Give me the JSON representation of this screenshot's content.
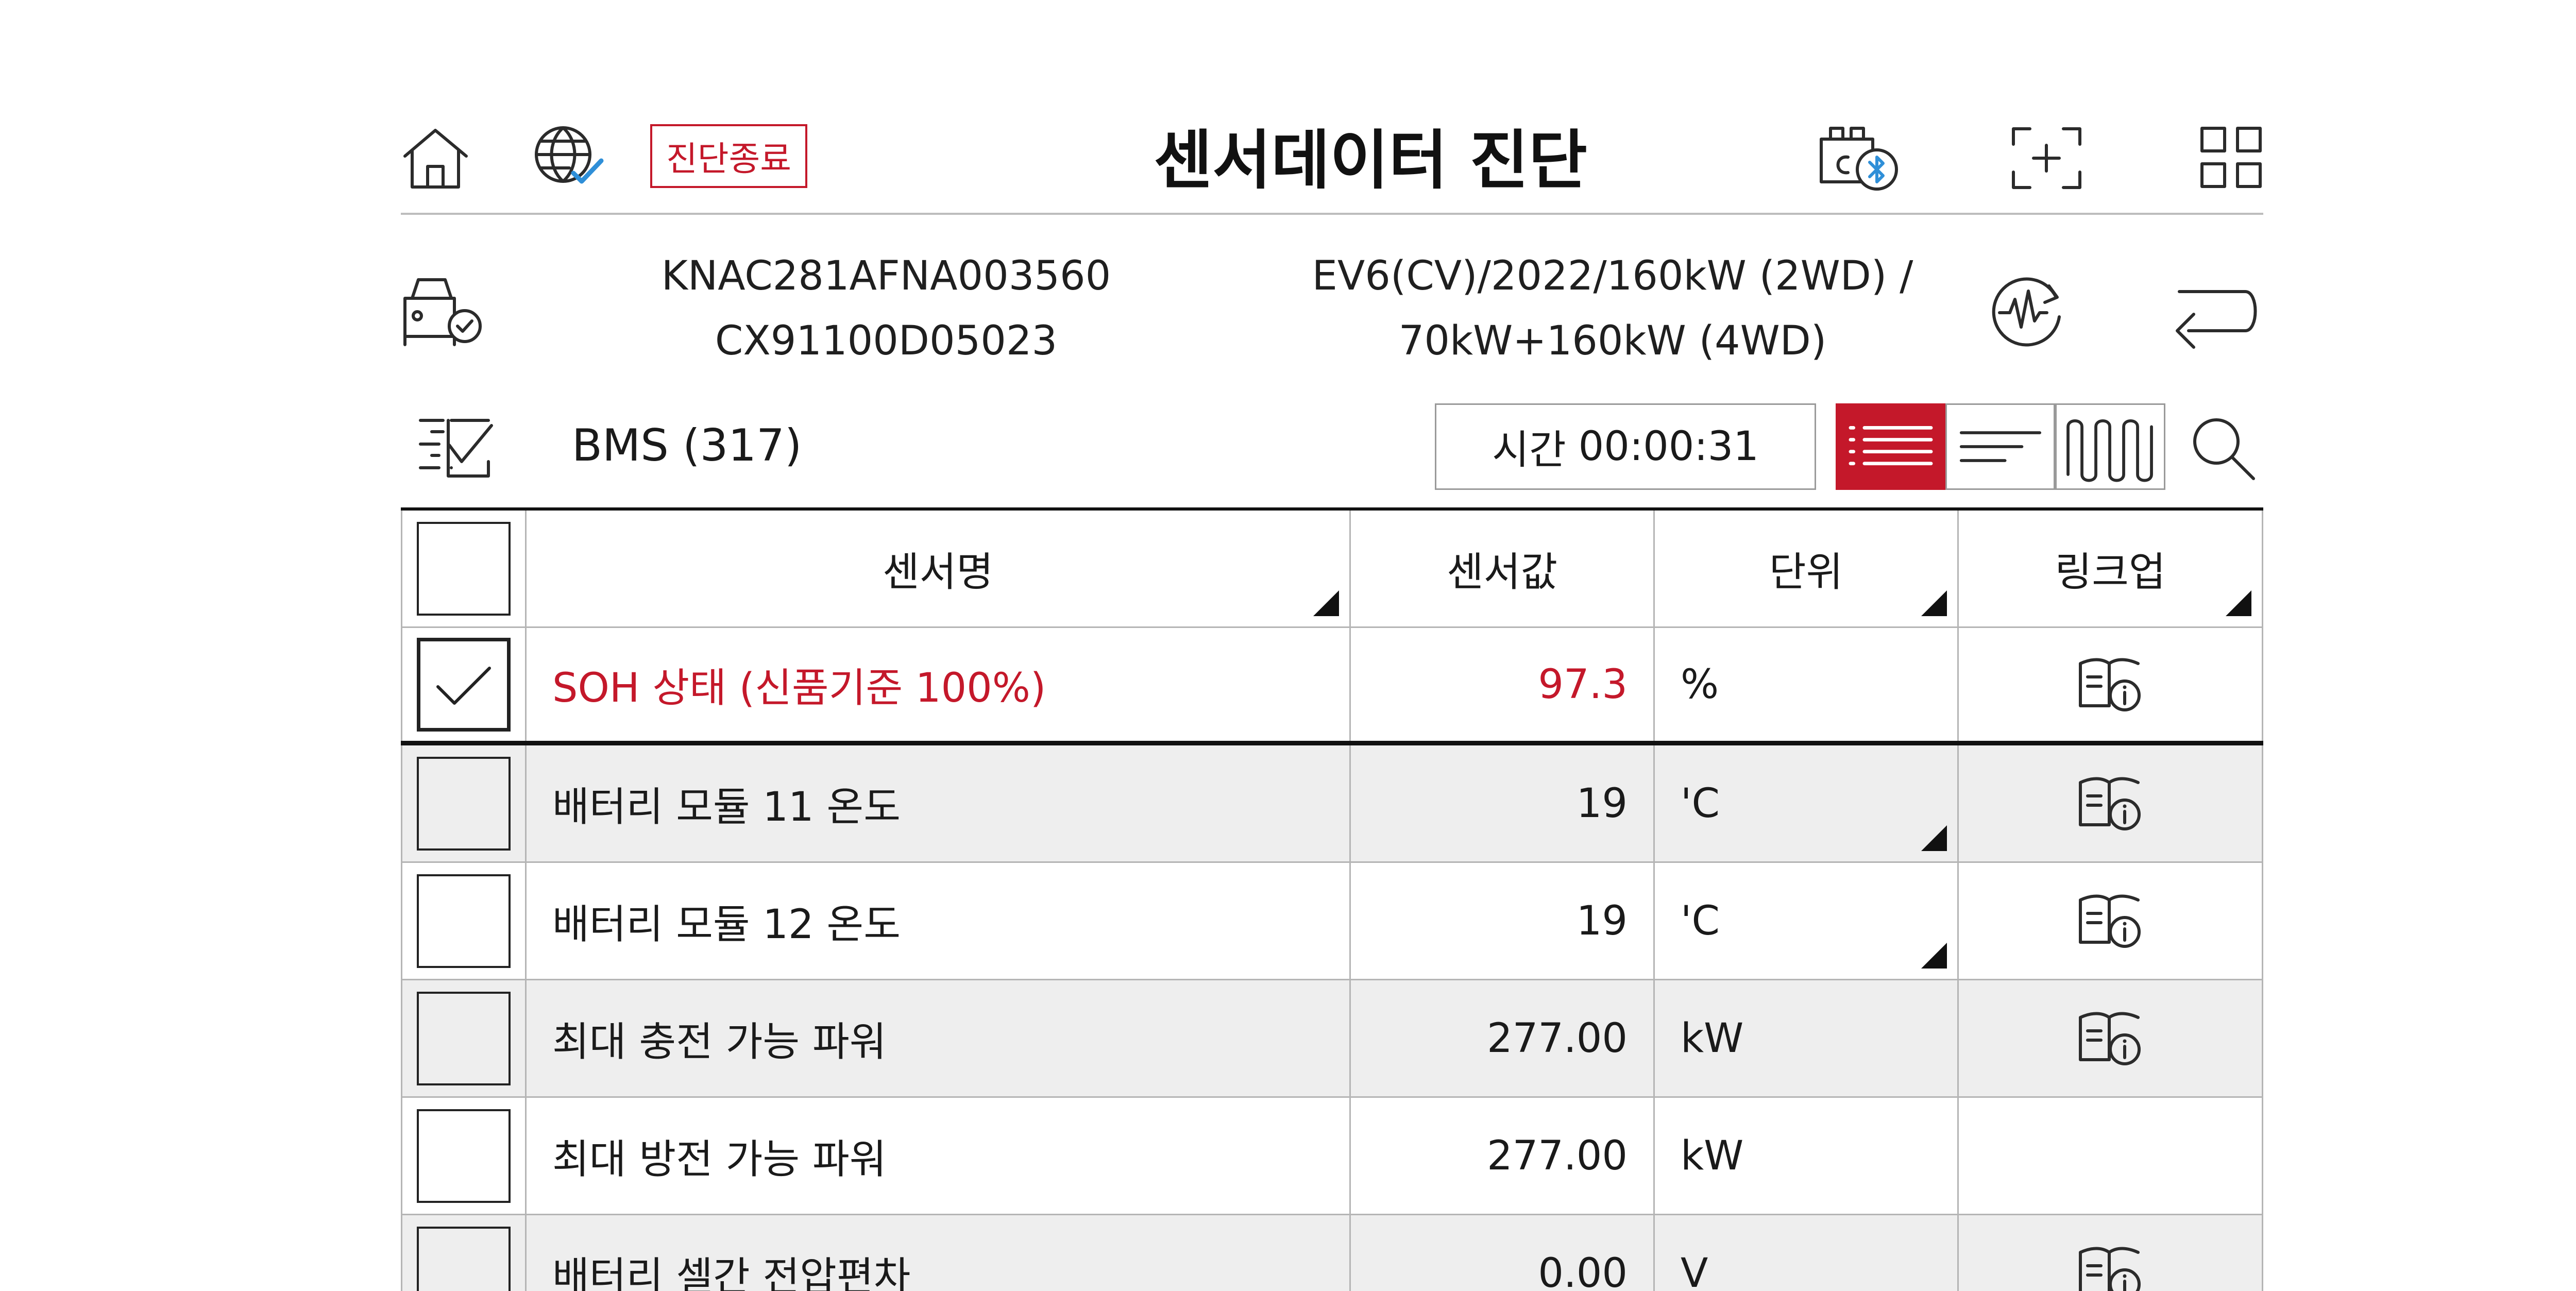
{
  "header": {
    "end_diagnosis_label": "진단종료",
    "title": "센서데이터 진단",
    "icons": [
      "home-icon",
      "globe-check-icon",
      "bluetooth-vci-icon",
      "screen-capture-icon",
      "grid-menu-icon"
    ]
  },
  "vehicle": {
    "vin": "KNAC281AFNA003560",
    "part_no": "CX91100D05023",
    "model_line1": "EV6(CV)/2022/160kW (2WD) /",
    "model_line2": "70kW+160kW (4WD)",
    "icons": [
      "vehicle-check-icon",
      "waveform-refresh-icon",
      "back-arrow-icon"
    ]
  },
  "toolbar": {
    "system": "BMS (317)",
    "time_label": "시간",
    "time_value": "00:00:31",
    "active_view": "list",
    "icons": [
      "checklist-icon",
      "list-view-icon",
      "text-view-icon",
      "wave-view-icon",
      "search-icon"
    ]
  },
  "table": {
    "columns": [
      "센서명",
      "센서값",
      "단위",
      "링크업"
    ],
    "rows": [
      {
        "name": "SOH 상태 (신품기준 100%)",
        "value": "97.3",
        "unit": "%",
        "checked": true,
        "has_link": true
      },
      {
        "name": "배터리 모듈 11 온도",
        "value": "19",
        "unit": "'C",
        "checked": false,
        "has_link": true
      },
      {
        "name": "배터리 모듈 12 온도",
        "value": "19",
        "unit": "'C",
        "checked": false,
        "has_link": true
      },
      {
        "name": "최대 충전 가능 파워",
        "value": "277.00",
        "unit": "kW",
        "checked": false,
        "has_link": true
      },
      {
        "name": "최대 방전 가능 파워",
        "value": "277.00",
        "unit": "kW",
        "checked": false,
        "has_link": false
      },
      {
        "name": "배터리 셀간 전압편차",
        "value": "0.00",
        "unit": "V",
        "checked": false,
        "has_link": true
      }
    ]
  },
  "colors": {
    "accent": "#c4182a",
    "row_shade": "#eeeeee"
  }
}
